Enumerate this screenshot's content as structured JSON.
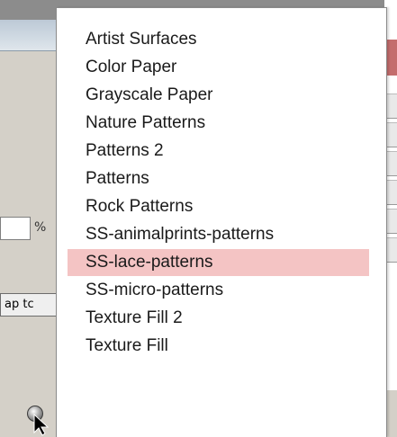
{
  "background": {
    "zoom_unit": "%",
    "snap_button_label": "ap tc"
  },
  "menu": {
    "selected_index": 8,
    "highlight_color": "#f4c4c4",
    "items": [
      "Artist Surfaces",
      "Color Paper",
      "Grayscale Paper",
      "Nature Patterns",
      "Patterns 2",
      "Patterns",
      "Rock Patterns",
      "SS-animalprints-patterns",
      "SS-lace-patterns",
      "SS-micro-patterns",
      "Texture Fill 2",
      "Texture Fill"
    ]
  }
}
